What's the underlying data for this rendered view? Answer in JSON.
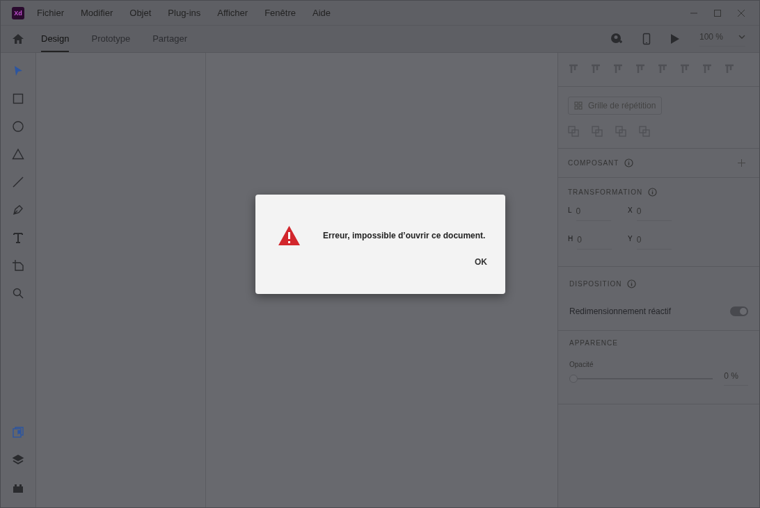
{
  "app": {
    "logo": "Xd"
  },
  "menu": [
    "Fichier",
    "Modifier",
    "Objet",
    "Plug-ins",
    "Afficher",
    "Fenêtre",
    "Aide"
  ],
  "tabs": [
    {
      "label": "Design",
      "selected": true
    },
    {
      "label": "Prototype",
      "selected": false
    },
    {
      "label": "Partager",
      "selected": false
    }
  ],
  "zoom": {
    "value": "100 %"
  },
  "tools": [
    {
      "kind": "select",
      "selected": true
    },
    {
      "kind": "rectangle",
      "selected": false
    },
    {
      "kind": "ellipse",
      "selected": false
    },
    {
      "kind": "polygon",
      "selected": false
    },
    {
      "kind": "line",
      "selected": false
    },
    {
      "kind": "pen",
      "selected": false
    },
    {
      "kind": "text",
      "selected": false
    },
    {
      "kind": "artboard",
      "selected": false
    },
    {
      "kind": "zoom",
      "selected": false
    }
  ],
  "bottom_tools": [
    {
      "kind": "assets",
      "selected": true
    },
    {
      "kind": "layers",
      "selected": false
    },
    {
      "kind": "plugins",
      "selected": false
    }
  ],
  "properties": {
    "repeat_grid": "Grille de répétition",
    "component": {
      "title": "COMPOSANT"
    },
    "transform": {
      "title": "TRANSFORMATION",
      "fields": [
        {
          "label": "L",
          "value": "0"
        },
        {
          "label": "X",
          "value": "0"
        },
        {
          "label": "H",
          "value": "0"
        },
        {
          "label": "Y",
          "value": "0"
        }
      ]
    },
    "layout": {
      "title": "DISPOSITION",
      "toggle_label": "Redimensionnement réactif",
      "on": true
    },
    "appearance": {
      "title": "APPARENCE",
      "opacity_label": "Opacité",
      "level": 0,
      "reading": "0 %"
    }
  },
  "dialog": {
    "message": "Erreur, impossible d’ouvrir ce document.",
    "button": "OK"
  }
}
